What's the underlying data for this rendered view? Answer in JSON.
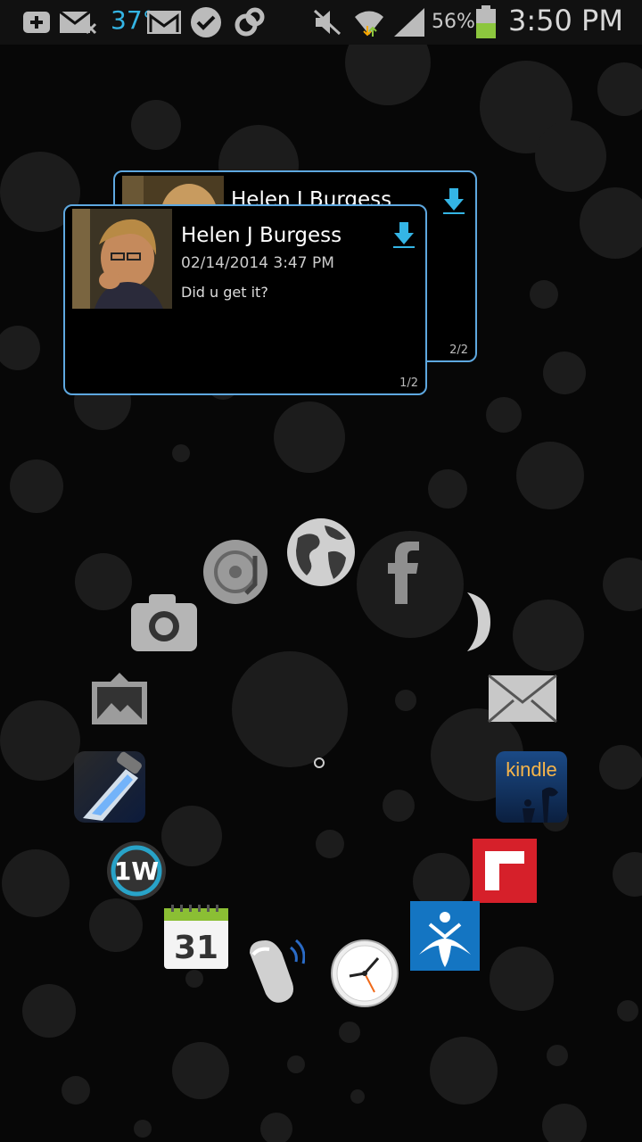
{
  "status_bar": {
    "temperature": "37°",
    "battery_percent": "56%",
    "time": "3:50 PM",
    "icons": [
      "add-box-icon",
      "missed-mail-icon",
      "gmail-icon",
      "check-badge-icon",
      "sync-icon",
      "mute-icon",
      "wifi-icon",
      "signal-icon",
      "battery-icon"
    ]
  },
  "notifications": {
    "front": {
      "name": "Helen J Burgess",
      "date": "02/14/2014 3:47 PM",
      "message": "Did u get it?",
      "page": "1/2"
    },
    "back": {
      "name": "Helen J Burgess",
      "page": "2/2"
    }
  },
  "apps": [
    "music-app",
    "browser-globe",
    "facebook",
    "moon-app",
    "camera",
    "email",
    "gallery",
    "kindle",
    "flashlight",
    "flipboard",
    "1weather",
    "myfitnesspal",
    "calendar",
    "whistle-app",
    "clock"
  ],
  "calendar_day": "31",
  "kindle_label": "kindle",
  "onew_label": "1W",
  "colors": {
    "accent": "#34b5e5",
    "card_border": "#5ea8e0",
    "battery": "#8cc63e"
  }
}
